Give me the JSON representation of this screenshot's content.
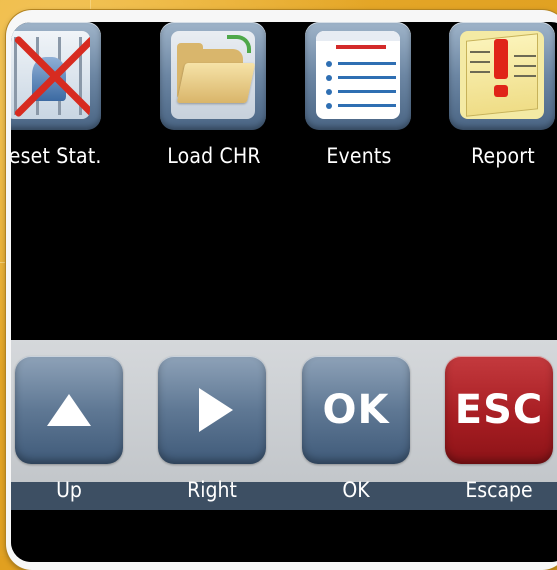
{
  "apps": [
    {
      "label": "Reset Stat.",
      "icon": "reset-statistics-icon"
    },
    {
      "label": "Load CHR",
      "icon": "folder-icon"
    },
    {
      "label": "Events",
      "icon": "event-list-icon"
    },
    {
      "label": "Report",
      "icon": "report-warning-icon"
    }
  ],
  "keys": [
    {
      "glyph": "",
      "label": "Up",
      "icon": "arrow-up-icon"
    },
    {
      "glyph": "",
      "label": "Right",
      "icon": "arrow-right-icon"
    },
    {
      "glyph": "OK",
      "label": "OK"
    },
    {
      "glyph": "ESC",
      "label": "Escape",
      "color": "#a81e23"
    }
  ],
  "colors": {
    "background": "#e1a020",
    "screen": "#000000",
    "key_blue": "#5f7894",
    "key_red": "#a81e23"
  }
}
